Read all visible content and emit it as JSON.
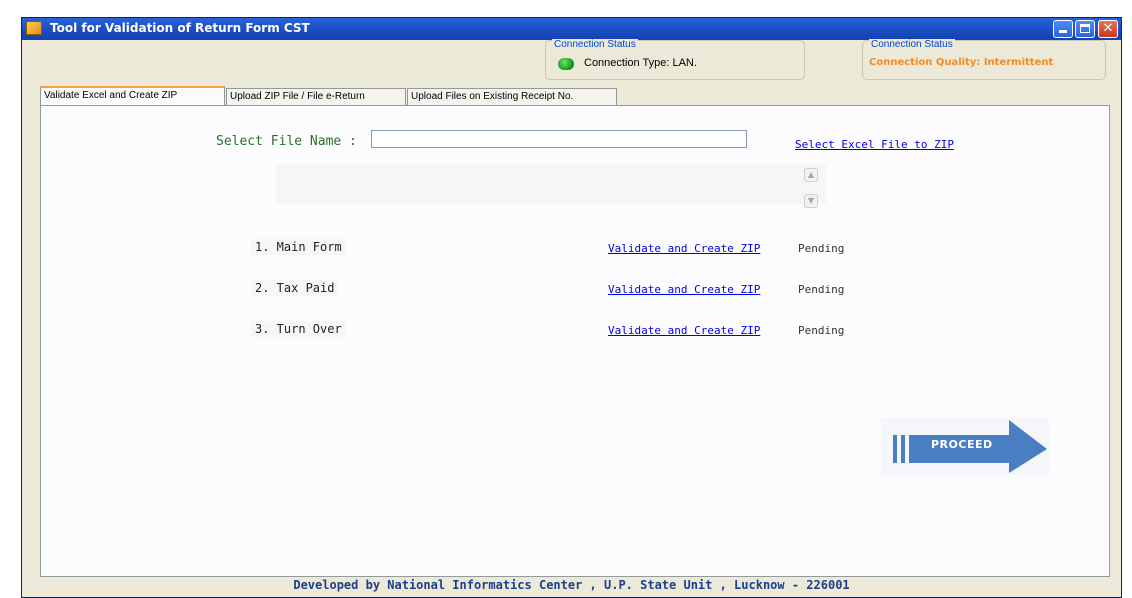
{
  "window": {
    "title": "Tool for Validation of Return Form CST",
    "controls": {
      "minimize": "minimize",
      "maximize": "maximize",
      "close": "✕"
    }
  },
  "connection": {
    "group1_legend": "Connection Status",
    "type_text": "Connection Type: LAN.",
    "group2_legend": "Connection Status",
    "quality_text": "Connection Quality: Intermittent",
    "quality_color": "#f08c2a",
    "led_color": "#139a13"
  },
  "tabs": [
    {
      "label": "Validate Excel and Create ZIP",
      "active": true
    },
    {
      "label": "Upload ZIP File / File e-Return",
      "active": false
    },
    {
      "label": "Upload Files on Existing Receipt No.",
      "active": false
    }
  ],
  "file_select": {
    "label": "Select File Name :",
    "value": "",
    "link": "Select Excel File to ZIP"
  },
  "rows": [
    {
      "label": "1. Main Form",
      "action": "Validate and Create ZIP",
      "status": "Pending"
    },
    {
      "label": "2. Tax Paid",
      "action": "Validate and Create ZIP",
      "status": "Pending"
    },
    {
      "label": "3. Turn Over",
      "action": "Validate and Create ZIP",
      "status": "Pending"
    }
  ],
  "proceed": {
    "label": "PROCEED",
    "color": "#4a7ec2"
  },
  "footer": "Developed by National Informatics Center , U.P. State Unit , Lucknow - 226001"
}
